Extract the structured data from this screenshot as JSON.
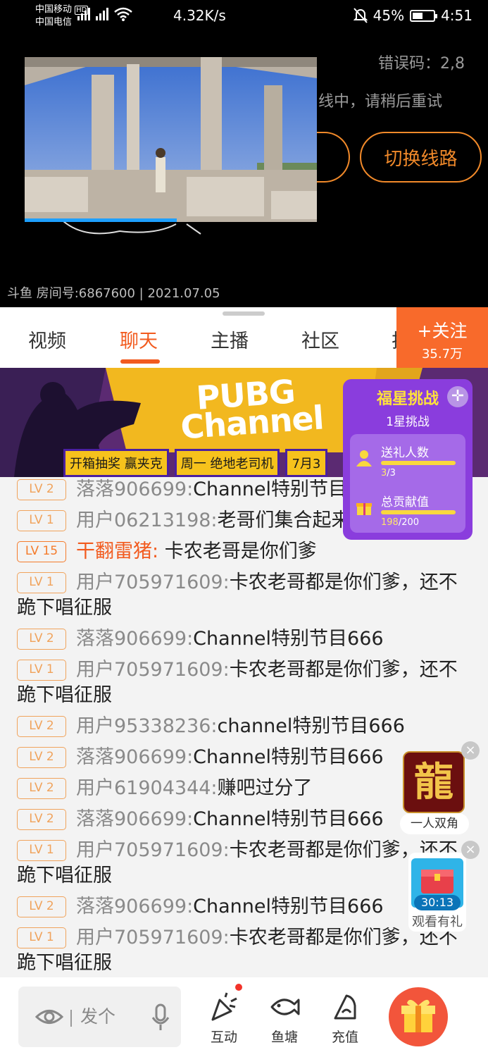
{
  "status_bar": {
    "carrier1": "中国移动",
    "carrier1_badge": "HD",
    "carrier2": "中国电信",
    "net_speed": "4.32K/s",
    "battery": "45%",
    "time": "4:51"
  },
  "player": {
    "error_code": "错误码：2,8",
    "error_message": "线中，请稍后重试",
    "switch_line_label": "切换线路",
    "watermark": "斗鱼 房间号:6867600 | 2021.07.05",
    "pip_progress": 0.52
  },
  "tabs": [
    {
      "label": "视频"
    },
    {
      "label": "聊天",
      "active": true
    },
    {
      "label": "主播"
    },
    {
      "label": "社区"
    },
    {
      "label": "排"
    }
  ],
  "follow": {
    "label": "关注",
    "count": "35.7万"
  },
  "banner": {
    "headline": "PUBG Channel",
    "tags": [
      "开箱抽奖 赢夹克",
      "周一 绝地老司机",
      "7月3"
    ]
  },
  "star_challenge": {
    "title": "福星挑战",
    "subtitle": "1星挑战",
    "tasks": [
      {
        "label": "送礼人数",
        "current": "3",
        "total": "/3"
      },
      {
        "label": "总贡献值",
        "current": "198",
        "total": "/200"
      }
    ]
  },
  "chat": [
    {
      "lv": "LV 2",
      "nick": "落落906699:",
      "text": "Channel特别节目666"
    },
    {
      "lv": "LV 1",
      "nick": "用户06213198:",
      "text": "老哥们集合起来"
    },
    {
      "lv": "LV 15",
      "nick": "干翻雷猪:",
      "text": " 卡农老哥是你们爹",
      "hot": true
    },
    {
      "lv": "LV 1",
      "nick": "用户705971609:",
      "text": "卡农老哥都是你们爹，还不跪下唱征服"
    },
    {
      "lv": "LV 2",
      "nick": "落落906699:",
      "text": "Channel特别节目666"
    },
    {
      "lv": "LV 1",
      "nick": "用户705971609:",
      "text": "卡农老哥都是你们爹，还不跪下唱征服"
    },
    {
      "lv": "LV 2",
      "nick": "用户95338236:",
      "text": "channel特别节目666"
    },
    {
      "lv": "LV 2",
      "nick": "落落906699:",
      "text": "Channel特别节目666"
    },
    {
      "lv": "LV 2",
      "nick": "用户61904344:",
      "text": "赚吧过分了"
    },
    {
      "lv": "LV 2",
      "nick": "落落906699:",
      "text": "Channel特别节目666"
    },
    {
      "lv": "LV 1",
      "nick": "用户705971609:",
      "text": "卡农老哥都是你们爹，还不跪下唱征服"
    },
    {
      "lv": "LV 2",
      "nick": "落落906699:",
      "text": "Channel特别节目666"
    },
    {
      "lv": "LV 1",
      "nick": "用户705971609:",
      "text": "卡农老哥都是你们爹，还不跪下唱征服"
    }
  ],
  "game_ad": {
    "caption": "一人双角",
    "glyph": "龍"
  },
  "gift_card": {
    "timer": "30:13",
    "caption": "观看有礼"
  },
  "bottom_bar": {
    "input_placeholder": "发个",
    "items": [
      {
        "label": "互动",
        "icon": "party-popper-icon"
      },
      {
        "label": "鱼塘",
        "icon": "fish-icon"
      },
      {
        "label": "充值",
        "icon": "recharge-icon"
      }
    ]
  },
  "colors": {
    "accent": "#f25b1f",
    "follow_bg": "#f86a2b",
    "panel_purple": "#8a3ddd"
  }
}
